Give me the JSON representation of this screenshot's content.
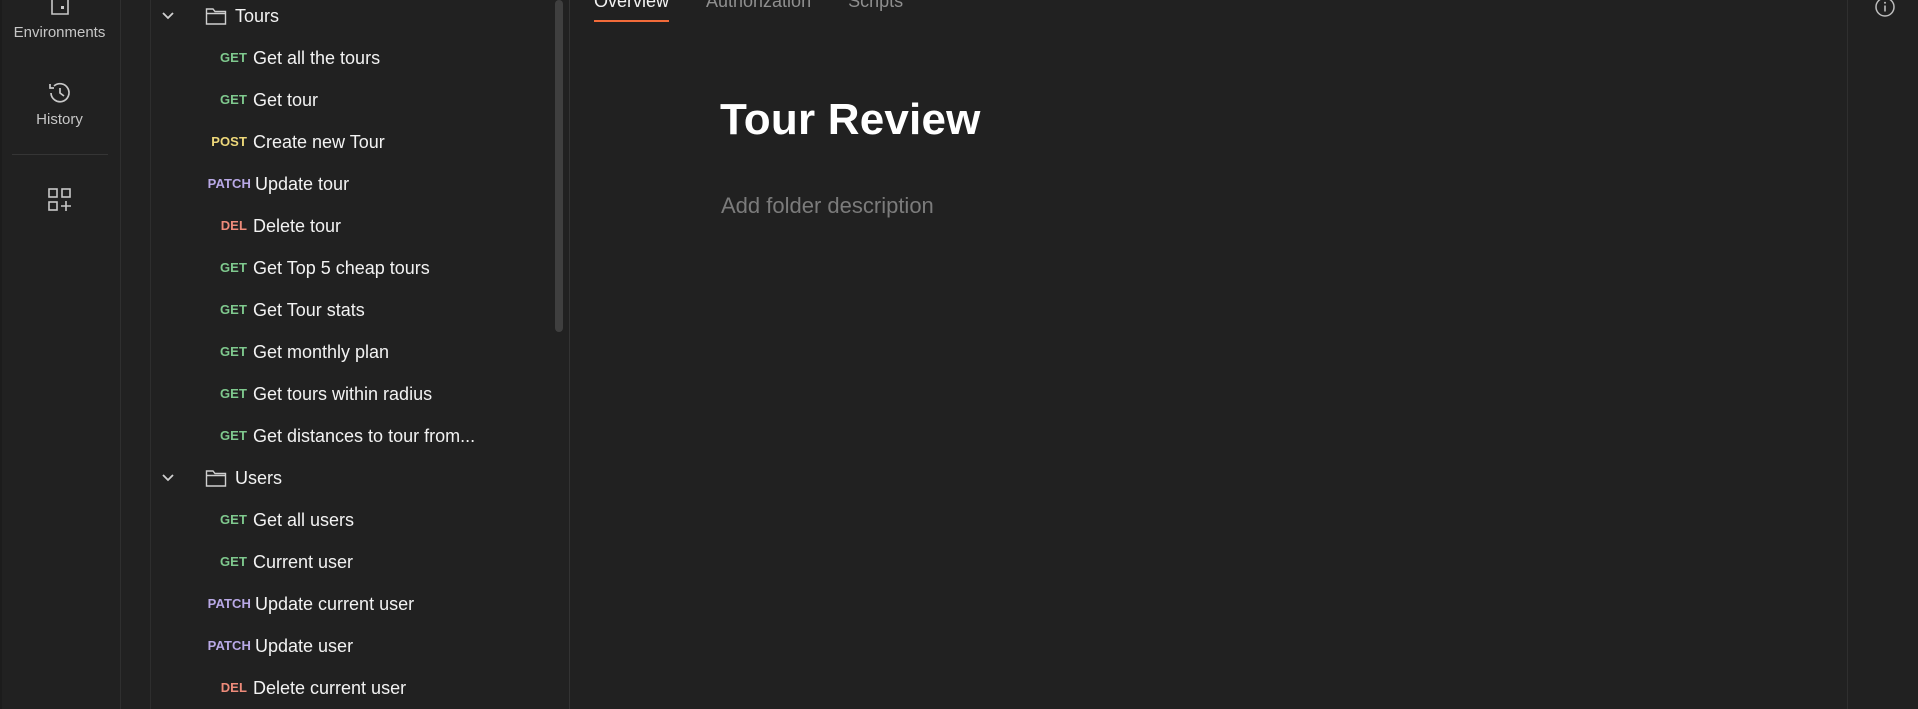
{
  "rail": {
    "environments_label": "Environments",
    "history_label": "History",
    "icons": [
      "environments-icon",
      "history-icon",
      "add-apps-icon"
    ]
  },
  "tree": {
    "folders": [
      {
        "name": "Tours",
        "requests": [
          {
            "method": "GET",
            "name": "Get all the tours"
          },
          {
            "method": "GET",
            "name": "Get tour"
          },
          {
            "method": "POST",
            "name": "Create new Tour"
          },
          {
            "method": "PATCH",
            "name": "Update tour"
          },
          {
            "method": "DEL",
            "name": "Delete tour"
          },
          {
            "method": "GET",
            "name": "Get Top 5 cheap tours"
          },
          {
            "method": "GET",
            "name": "Get Tour stats"
          },
          {
            "method": "GET",
            "name": "Get monthly plan"
          },
          {
            "method": "GET",
            "name": "Get tours within radius"
          },
          {
            "method": "GET",
            "name": "Get distances to tour from..."
          }
        ]
      },
      {
        "name": "Users",
        "requests": [
          {
            "method": "GET",
            "name": "Get all users"
          },
          {
            "method": "GET",
            "name": "Current user"
          },
          {
            "method": "PATCH",
            "name": "Update current user"
          },
          {
            "method": "PATCH",
            "name": "Update user"
          },
          {
            "method": "DEL",
            "name": "Delete current user"
          }
        ]
      }
    ]
  },
  "main": {
    "tabs": [
      {
        "label": "Overview",
        "active": true
      },
      {
        "label": "Authorization",
        "active": false
      },
      {
        "label": "Scripts",
        "active": false
      }
    ],
    "title": "Tour Review",
    "description_placeholder": "Add folder description"
  },
  "colors": {
    "get": "#7fc98e",
    "post": "#eed87a",
    "patch": "#b9a9e6",
    "del": "#ee8b7a",
    "accent": "#f26b3a"
  }
}
